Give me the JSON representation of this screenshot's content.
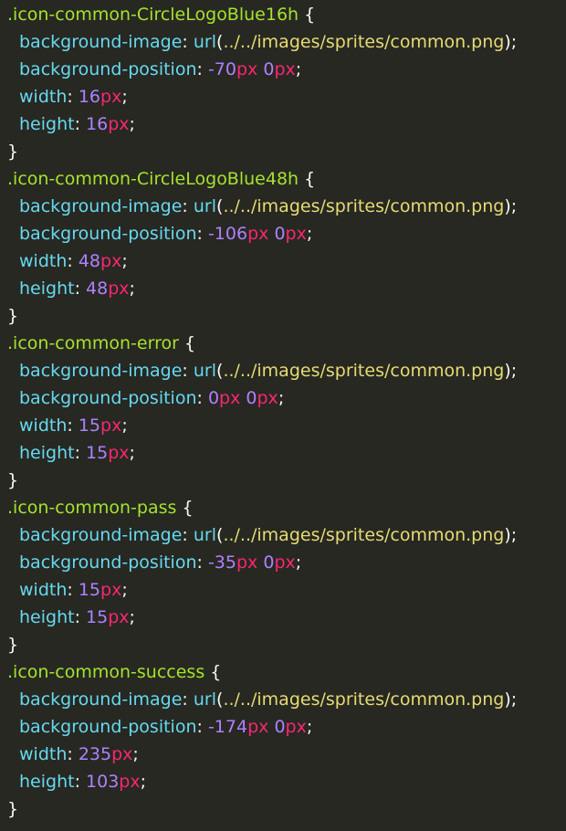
{
  "rules": [
    {
      "selector": ".icon-common-CircleLogoBlue16h",
      "image_prop": "background-image",
      "image_url": "../../images/sprites/common.png",
      "position_prop": "background-position",
      "pos_x": "-70",
      "pos_x_unit": "px",
      "pos_y": "0",
      "pos_y_unit": "px",
      "width_prop": "width",
      "width_val": "16",
      "width_unit": "px",
      "height_prop": "height",
      "height_val": "16",
      "height_unit": "px"
    },
    {
      "selector": ".icon-common-CircleLogoBlue48h",
      "image_prop": "background-image",
      "image_url": "../../images/sprites/common.png",
      "position_prop": "background-position",
      "pos_x": "-106",
      "pos_x_unit": "px",
      "pos_y": "0",
      "pos_y_unit": "px",
      "width_prop": "width",
      "width_val": "48",
      "width_unit": "px",
      "height_prop": "height",
      "height_val": "48",
      "height_unit": "px"
    },
    {
      "selector": ".icon-common-error",
      "image_prop": "background-image",
      "image_url": "../../images/sprites/common.png",
      "position_prop": "background-position",
      "pos_x": "0",
      "pos_x_unit": "px",
      "pos_y": "0",
      "pos_y_unit": "px",
      "width_prop": "width",
      "width_val": "15",
      "width_unit": "px",
      "height_prop": "height",
      "height_val": "15",
      "height_unit": "px"
    },
    {
      "selector": ".icon-common-pass",
      "image_prop": "background-image",
      "image_url": "../../images/sprites/common.png",
      "position_prop": "background-position",
      "pos_x": "-35",
      "pos_x_unit": "px",
      "pos_y": "0",
      "pos_y_unit": "px",
      "width_prop": "width",
      "width_val": "15",
      "width_unit": "px",
      "height_prop": "height",
      "height_val": "15",
      "height_unit": "px"
    },
    {
      "selector": ".icon-common-success",
      "image_prop": "background-image",
      "image_url": "../../images/sprites/common.png",
      "position_prop": "background-position",
      "pos_x": "-174",
      "pos_x_unit": "px",
      "pos_y": "0",
      "pos_y_unit": "px",
      "width_prop": "width",
      "width_val": "235",
      "width_unit": "px",
      "height_prop": "height",
      "height_val": "103",
      "height_unit": "px"
    }
  ],
  "colors": {
    "background": "#272822",
    "selector": "#a6e22e",
    "property": "#66d9ef",
    "string": "#e6db74",
    "number": "#ae81ff",
    "unit": "#f92672",
    "punctuation": "#f8f8f2"
  }
}
